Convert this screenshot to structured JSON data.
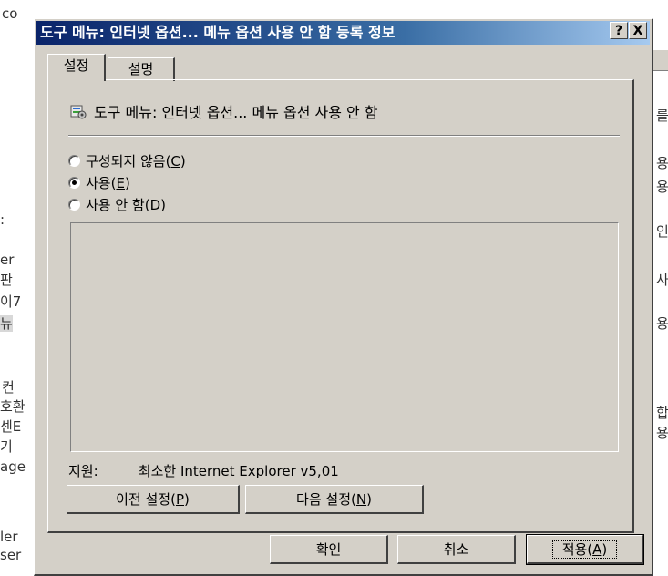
{
  "background": {
    "top_left": "co",
    "left_fragments": [
      ":",
      "er",
      "판",
      "이7",
      "뉴",
      "컨",
      "호환",
      "센E",
      "기",
      "age",
      "ler",
      "ser"
    ],
    "right_fragments": [
      "를",
      "용",
      "용",
      "인",
      "사",
      "용",
      "합",
      "용"
    ]
  },
  "dialog": {
    "title": "도구 메뉴: 인터넷 옵션... 메뉴 옵션 사용 안 함 등록 정보",
    "help_button": "?",
    "close_button": "X",
    "tabs": [
      {
        "label": "설정",
        "active": true
      },
      {
        "label": "설명",
        "active": false
      }
    ],
    "policy_name": "도구 메뉴: 인터넷 옵션... 메뉴 옵션 사용 안 함",
    "radios": [
      {
        "text": "구성되지 않음(",
        "key": "C",
        "close": ")",
        "checked": false
      },
      {
        "text": "사용(",
        "key": "E",
        "close": ")",
        "checked": true
      },
      {
        "text": "사용 안 함(",
        "key": "D",
        "close": ")",
        "checked": false
      }
    ],
    "support_label": "지원:",
    "support_value": "최소한 Internet Explorer v5,01",
    "prev_button": {
      "text": "이전 설정(",
      "key": "P",
      "close": ")"
    },
    "next_button": {
      "text": "다음 설정(",
      "key": "N",
      "close": ")"
    },
    "ok_button": "확인",
    "cancel_button": "취소",
    "apply_button": {
      "text": "적용(",
      "key": "A",
      "close": ")"
    }
  },
  "colors": {
    "dialog_face": "#d4d0c8",
    "title_start": "#0a246a",
    "title_end": "#a6caf0"
  }
}
